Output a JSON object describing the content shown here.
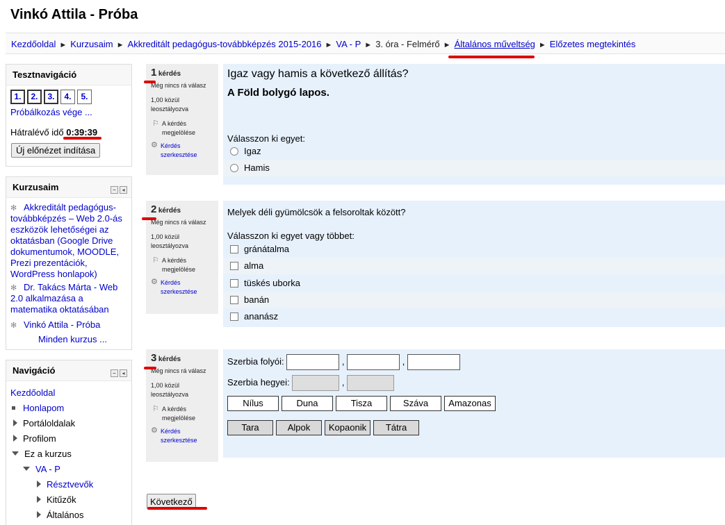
{
  "site_title": "Vinkó Attila - Próba",
  "breadcrumb": {
    "items": [
      "Kezdőoldal",
      "Kurzusaim",
      "Akkreditált pedagógus-továbbképzés 2015-2016",
      "VA - P",
      "3. óra - Felmérő",
      "Általános műveltség",
      "Előzetes megtekintés"
    ],
    "separator": "►"
  },
  "quiz_nav": {
    "title": "Tesztnavigáció",
    "buttons": [
      "1.",
      "2.",
      "3.",
      "4.",
      "5."
    ],
    "finish": "Próbálkozás vége ...",
    "time_label": "Hátralévő idő",
    "time_value": "0:39:39",
    "new_preview": "Új előnézet indítása"
  },
  "courses": {
    "title": "Kurzusaim",
    "items": [
      "Akkreditált pedagógus-továbbképzés – Web 2.0-ás eszközök lehetőségei az oktatásban (Google Drive dokumentumok, MOODLE, Prezi prezentációk, WordPress honlapok)",
      "Dr. Takács Márta - Web 2.0 alkalmazása a matematika oktatásában",
      "Vinkó Attila - Próba"
    ],
    "all": "Minden kurzus ..."
  },
  "navigation": {
    "title": "Navigáció",
    "home": "Kezdőoldal",
    "items": [
      "Honlapom",
      "Portáloldalak",
      "Profilom",
      "Ez a kurzus",
      "VA - P",
      "Résztvevők",
      "Kitűzők",
      "Általános"
    ]
  },
  "question_info": {
    "word": "kérdés",
    "state": "Még nincs rá válasz",
    "grade": "1,00 közül leosztályozva",
    "flag": "A kérdés megjelölése",
    "edit": "Kérdés szerkesztése"
  },
  "q1": {
    "no": "1",
    "text": "Igaz vagy hamis a következő állítás?",
    "statement": "A Föld bolygó lapos.",
    "prompt": "Válasszon ki egyet:",
    "options": [
      "Igaz",
      "Hamis"
    ]
  },
  "q2": {
    "no": "2",
    "text": "Melyek déli gyümölcsök a felsoroltak között?",
    "prompt": "Válasszon ki egyet vagy többet:",
    "options": [
      "gránátalma",
      "alma",
      "tüskés uborka",
      "banán",
      "ananász"
    ]
  },
  "q3": {
    "no": "3",
    "rivers_label": "Szerbia folyói:",
    "mountains_label": "Szerbia hegyei:",
    "comma": ",",
    "rivers": [
      "Nílus",
      "Duna",
      "Tisza",
      "Száva",
      "Amazonas"
    ],
    "mountains": [
      "Tara",
      "Alpok",
      "Kopaonik",
      "Tátra"
    ]
  },
  "next_button": "Következő",
  "colors": {
    "link": "#0000cc",
    "highlight": "#e00000",
    "question_bg": "#e7f1fc",
    "info_bg": "#eeeeee"
  }
}
